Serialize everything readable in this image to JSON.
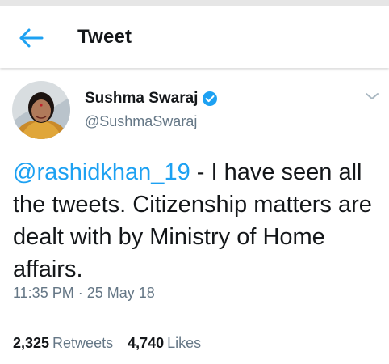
{
  "header": {
    "title": "Tweet"
  },
  "icons": {
    "back": "arrow-left-icon",
    "verified": "verified-badge-icon",
    "menu": "chevron-down-icon"
  },
  "colors": {
    "accent": "#1da1f2",
    "text": "#14171a",
    "secondary": "#657786"
  },
  "tweet": {
    "author_name": "Sushma Swaraj",
    "author_handle": "@SushmaSwaraj",
    "mention": "@rashidkhan_19",
    "body": " - I have seen all the tweets. Citizenship matters are dealt with by Ministry of Home affairs.",
    "time": "11:35 PM",
    "separator": " · ",
    "date": "25 May 18"
  },
  "stats": {
    "retweets_count": "2,325",
    "retweets_label": "Retweets",
    "likes_count": "4,740",
    "likes_label": "Likes"
  }
}
